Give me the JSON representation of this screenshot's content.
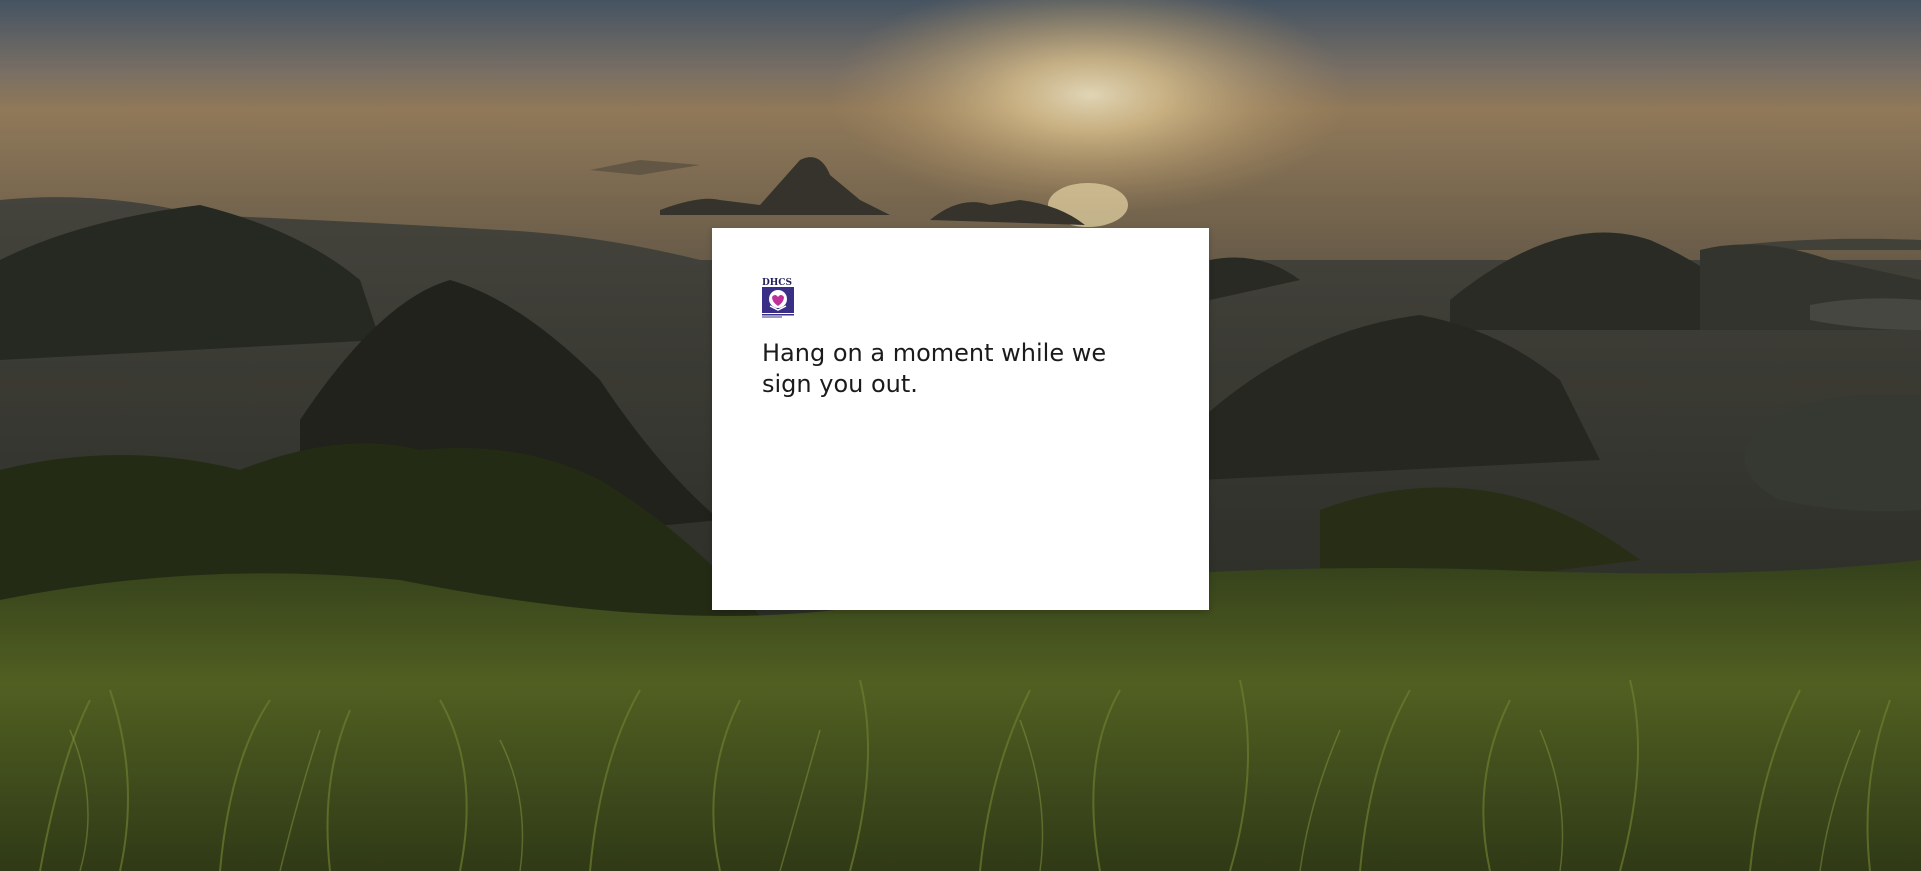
{
  "background": {
    "icon": "landscape-sunrise-image",
    "sky_top": "#5c6a78",
    "sky_horizon": "#b9935f",
    "grass": "#5a6a24"
  },
  "logo": {
    "icon": "dhcs-logo-icon",
    "text": "DHCS",
    "primary_color": "#3a2f86",
    "accent_color": "#c0309a"
  },
  "message": {
    "title": "Hang on a moment while we sign you out."
  }
}
